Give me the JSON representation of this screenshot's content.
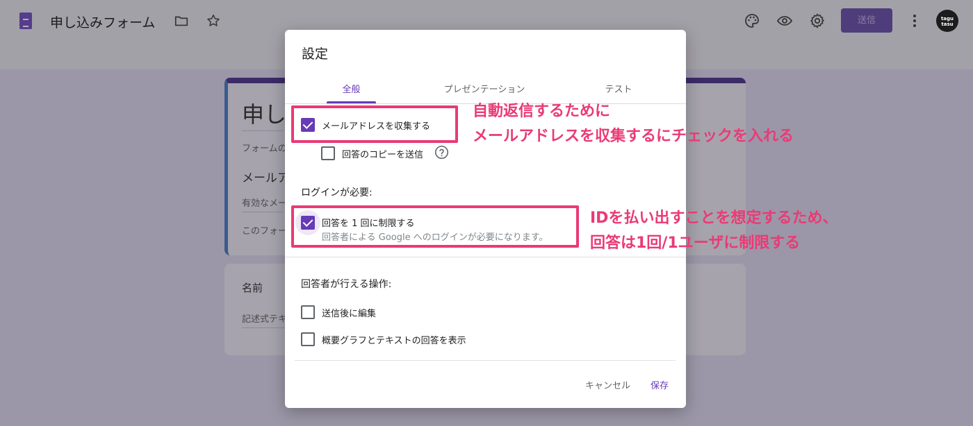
{
  "app": {
    "title": "申し込みフォーム",
    "send_label": "送信",
    "avatar_text_1": "tagu",
    "avatar_text_2": "tasu"
  },
  "background_form": {
    "card1_title": "申し",
    "card1_desc": "フォームの",
    "card1_email_label": "メールア",
    "card1_email_hint": "有効なメー",
    "card1_note": "このフォー",
    "card2_name": "名前",
    "card2_placeholder": "記述式テキ"
  },
  "dialog": {
    "title": "設定",
    "tabs": [
      {
        "label": "全般",
        "active": true
      },
      {
        "label": "プレゼンテーション",
        "active": false
      },
      {
        "label": "テスト",
        "active": false
      }
    ],
    "collect_email": {
      "label": "メールアドレスを収集する",
      "checked": true
    },
    "send_copy": {
      "label": "回答のコピーを送信",
      "checked": false
    },
    "login_section": "ログインが必要:",
    "limit_one": {
      "label": "回答を 1 回に制限する",
      "checked": true,
      "sub": "回答者による Google へのログインが必要になります。"
    },
    "respondent_section": "回答者が行える操作:",
    "edit_after": {
      "label": "送信後に編集",
      "checked": false
    },
    "show_summary": {
      "label": "概要グラフとテキストの回答を表示",
      "checked": false
    },
    "cancel_label": "キャンセル",
    "save_label": "保存"
  },
  "annotations": {
    "note1_line1": "自動返信するために",
    "note1_line2": "メールアドレスを収集するにチェックを入れる",
    "note2_line1": "IDを払い出すことを想定するため、",
    "note2_line2": "回答は1回/1ユーザに制限する"
  },
  "colors": {
    "accent": "#673ab7",
    "annotation": "#ea3a75"
  }
}
